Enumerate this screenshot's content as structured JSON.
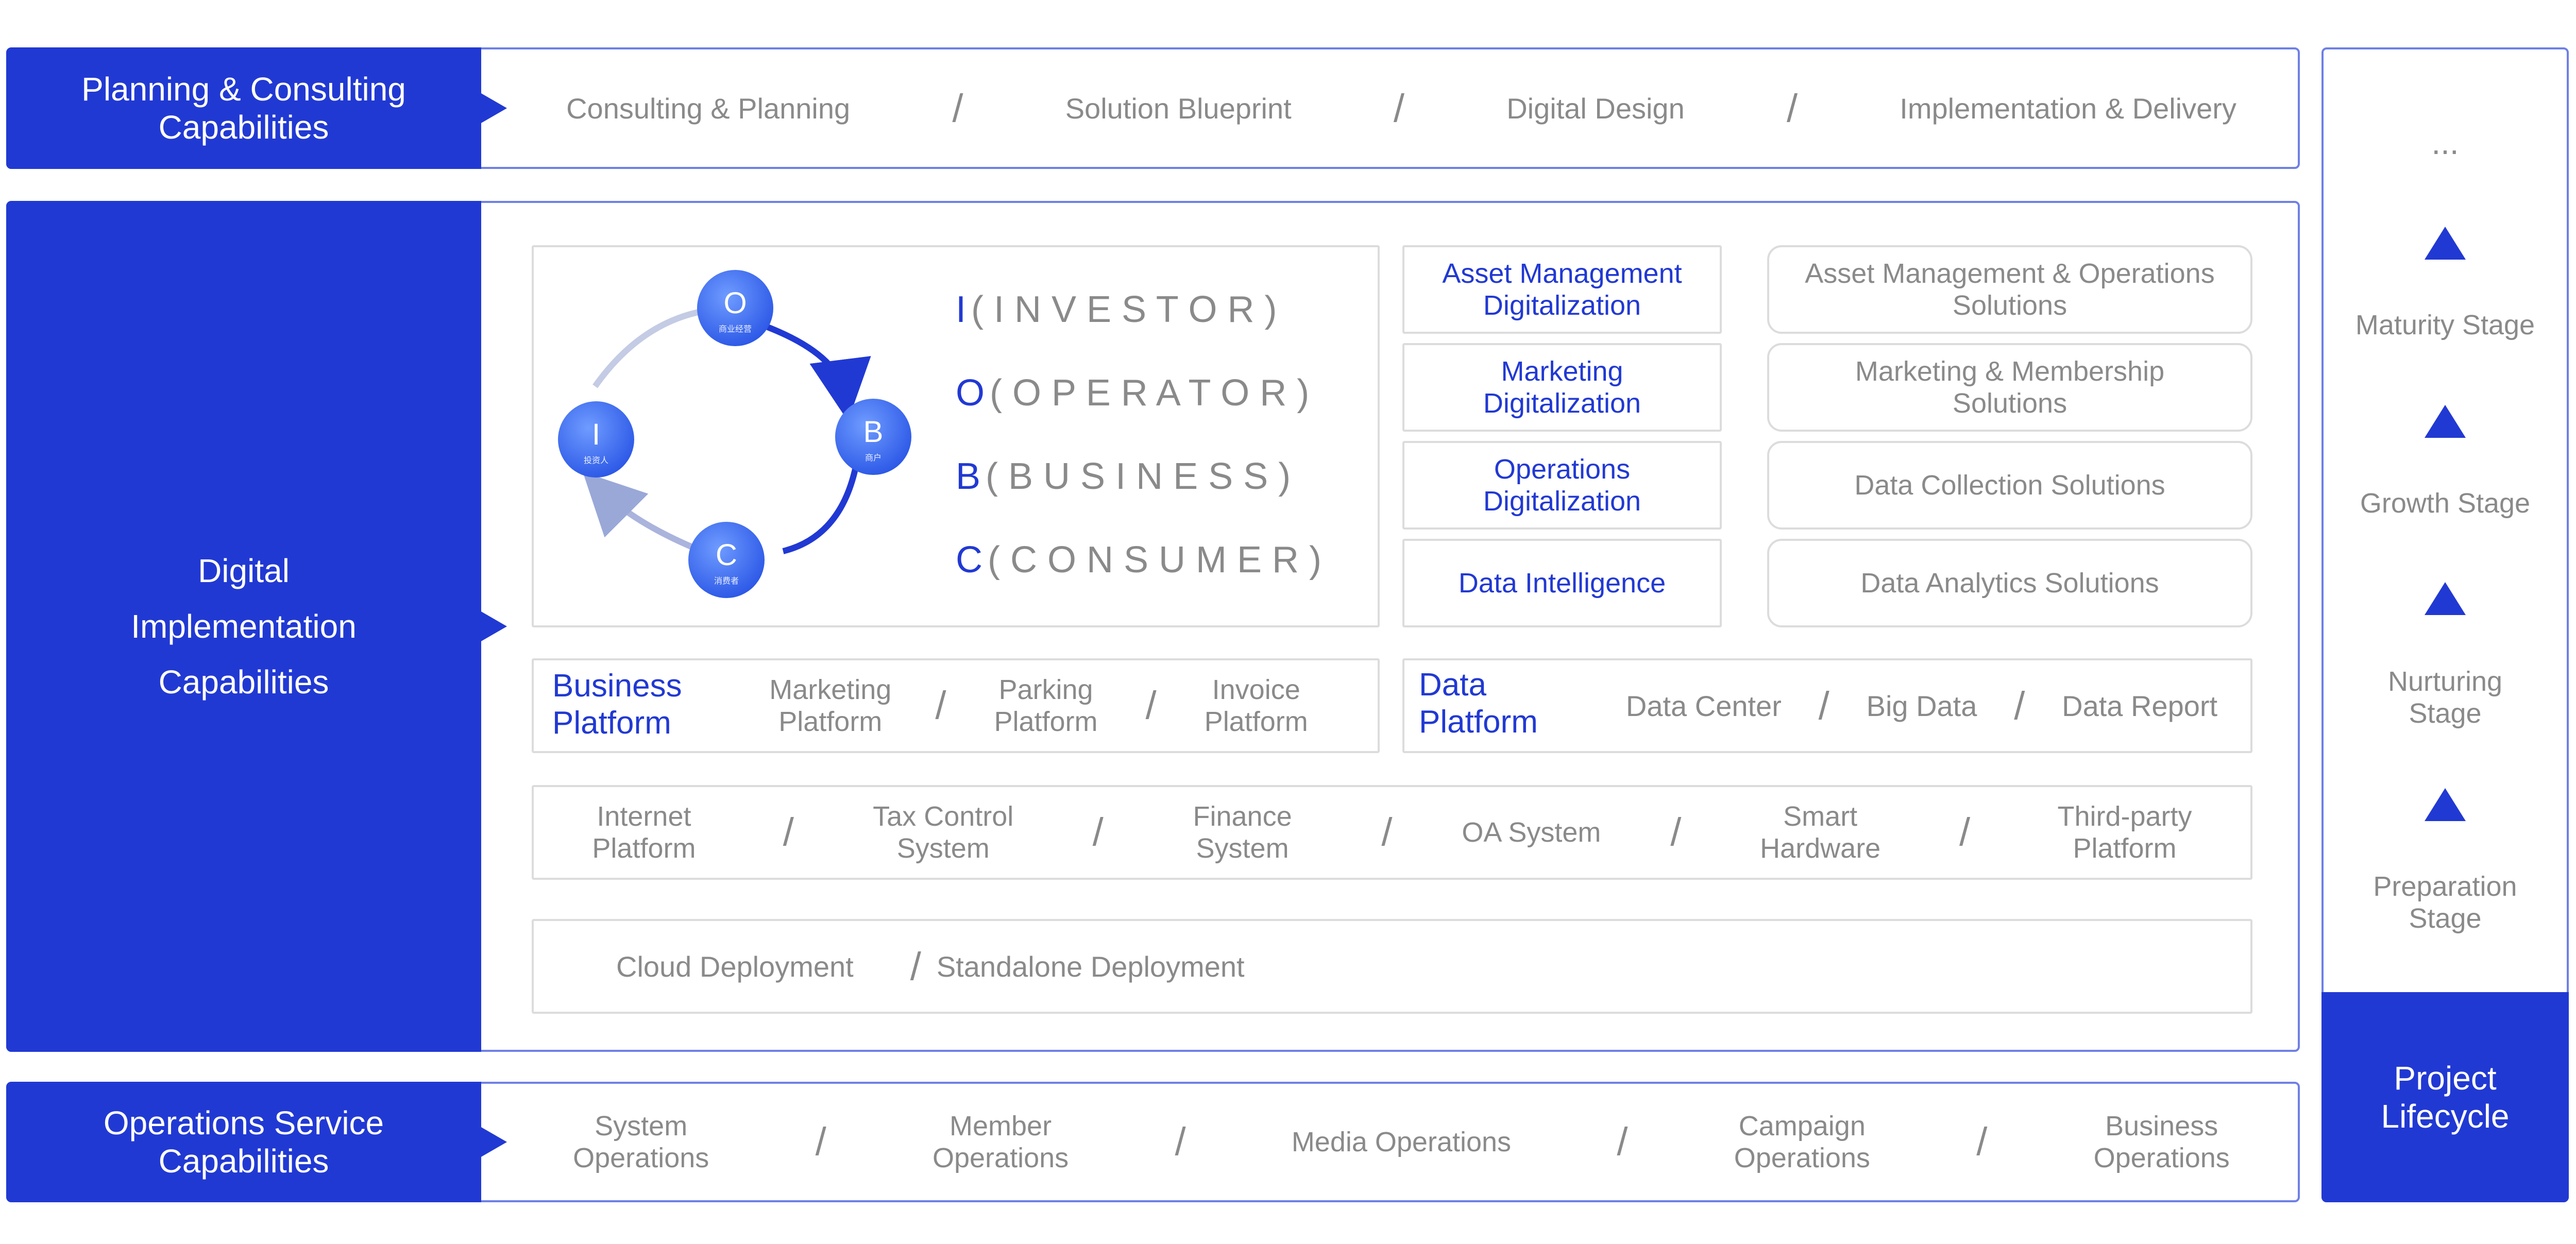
{
  "planning": {
    "title": "Planning & Consulting Capabilities",
    "items": [
      "Consulting & Planning",
      "Solution Blueprint",
      "Digital Design",
      "Implementation & Delivery"
    ]
  },
  "digital": {
    "title_lines": [
      "Digital",
      "Implementation",
      "Capabilities"
    ],
    "cycle": {
      "nodes": [
        {
          "letter": "O",
          "sub": "商业经营"
        },
        {
          "letter": "B",
          "sub": "商户"
        },
        {
          "letter": "C",
          "sub": "消费者"
        },
        {
          "letter": "I",
          "sub": "投资人"
        }
      ]
    },
    "roles": [
      {
        "letter": "I",
        "text": "( I N V E S T O R )"
      },
      {
        "letter": "O",
        "text": "( O P E R A T O R )"
      },
      {
        "letter": "B",
        "text": "( B U S I N E S S )"
      },
      {
        "letter": "C",
        "text": "( C O N S U M E R )"
      }
    ],
    "digitalization": [
      "Asset Management Digitalization",
      "Marketing Digitalization",
      "Operations Digitalization",
      "Data Intelligence"
    ],
    "solutions": [
      "Asset Management & Operations Solutions",
      "Marketing & Membership Solutions",
      "Data Collection Solutions",
      "Data Analytics Solutions"
    ],
    "business_platform": {
      "title": "Business Platform",
      "items": [
        "Marketing Platform",
        "Parking Platform",
        "Invoice Platform"
      ]
    },
    "data_platform": {
      "title": "Data Platform",
      "items": [
        "Data Center",
        "Big Data",
        "Data Report"
      ]
    },
    "integrations": [
      "Internet Platform",
      "Tax Control System",
      "Finance System",
      "OA System",
      "Smart Hardware",
      "Third-party Platform"
    ],
    "deployment": [
      "Cloud Deployment",
      "Standalone Deployment"
    ]
  },
  "operations": {
    "title": "Operations Service Capabilities",
    "items": [
      "System Operations",
      "Member Operations",
      "Media Operations",
      "Campaign Operations",
      "Business Operations"
    ]
  },
  "lifecycle": {
    "ellipsis": "...",
    "stages": [
      "Maturity Stage",
      "Growth Stage",
      "Nurturing Stage",
      "Preparation Stage"
    ],
    "title": "Project Lifecycle"
  },
  "separator": "/",
  "colors": {
    "accent": "#2139d3",
    "frame": "#6f80e6",
    "text": "#8a8a8a",
    "box_border": "#dcdcdc"
  }
}
